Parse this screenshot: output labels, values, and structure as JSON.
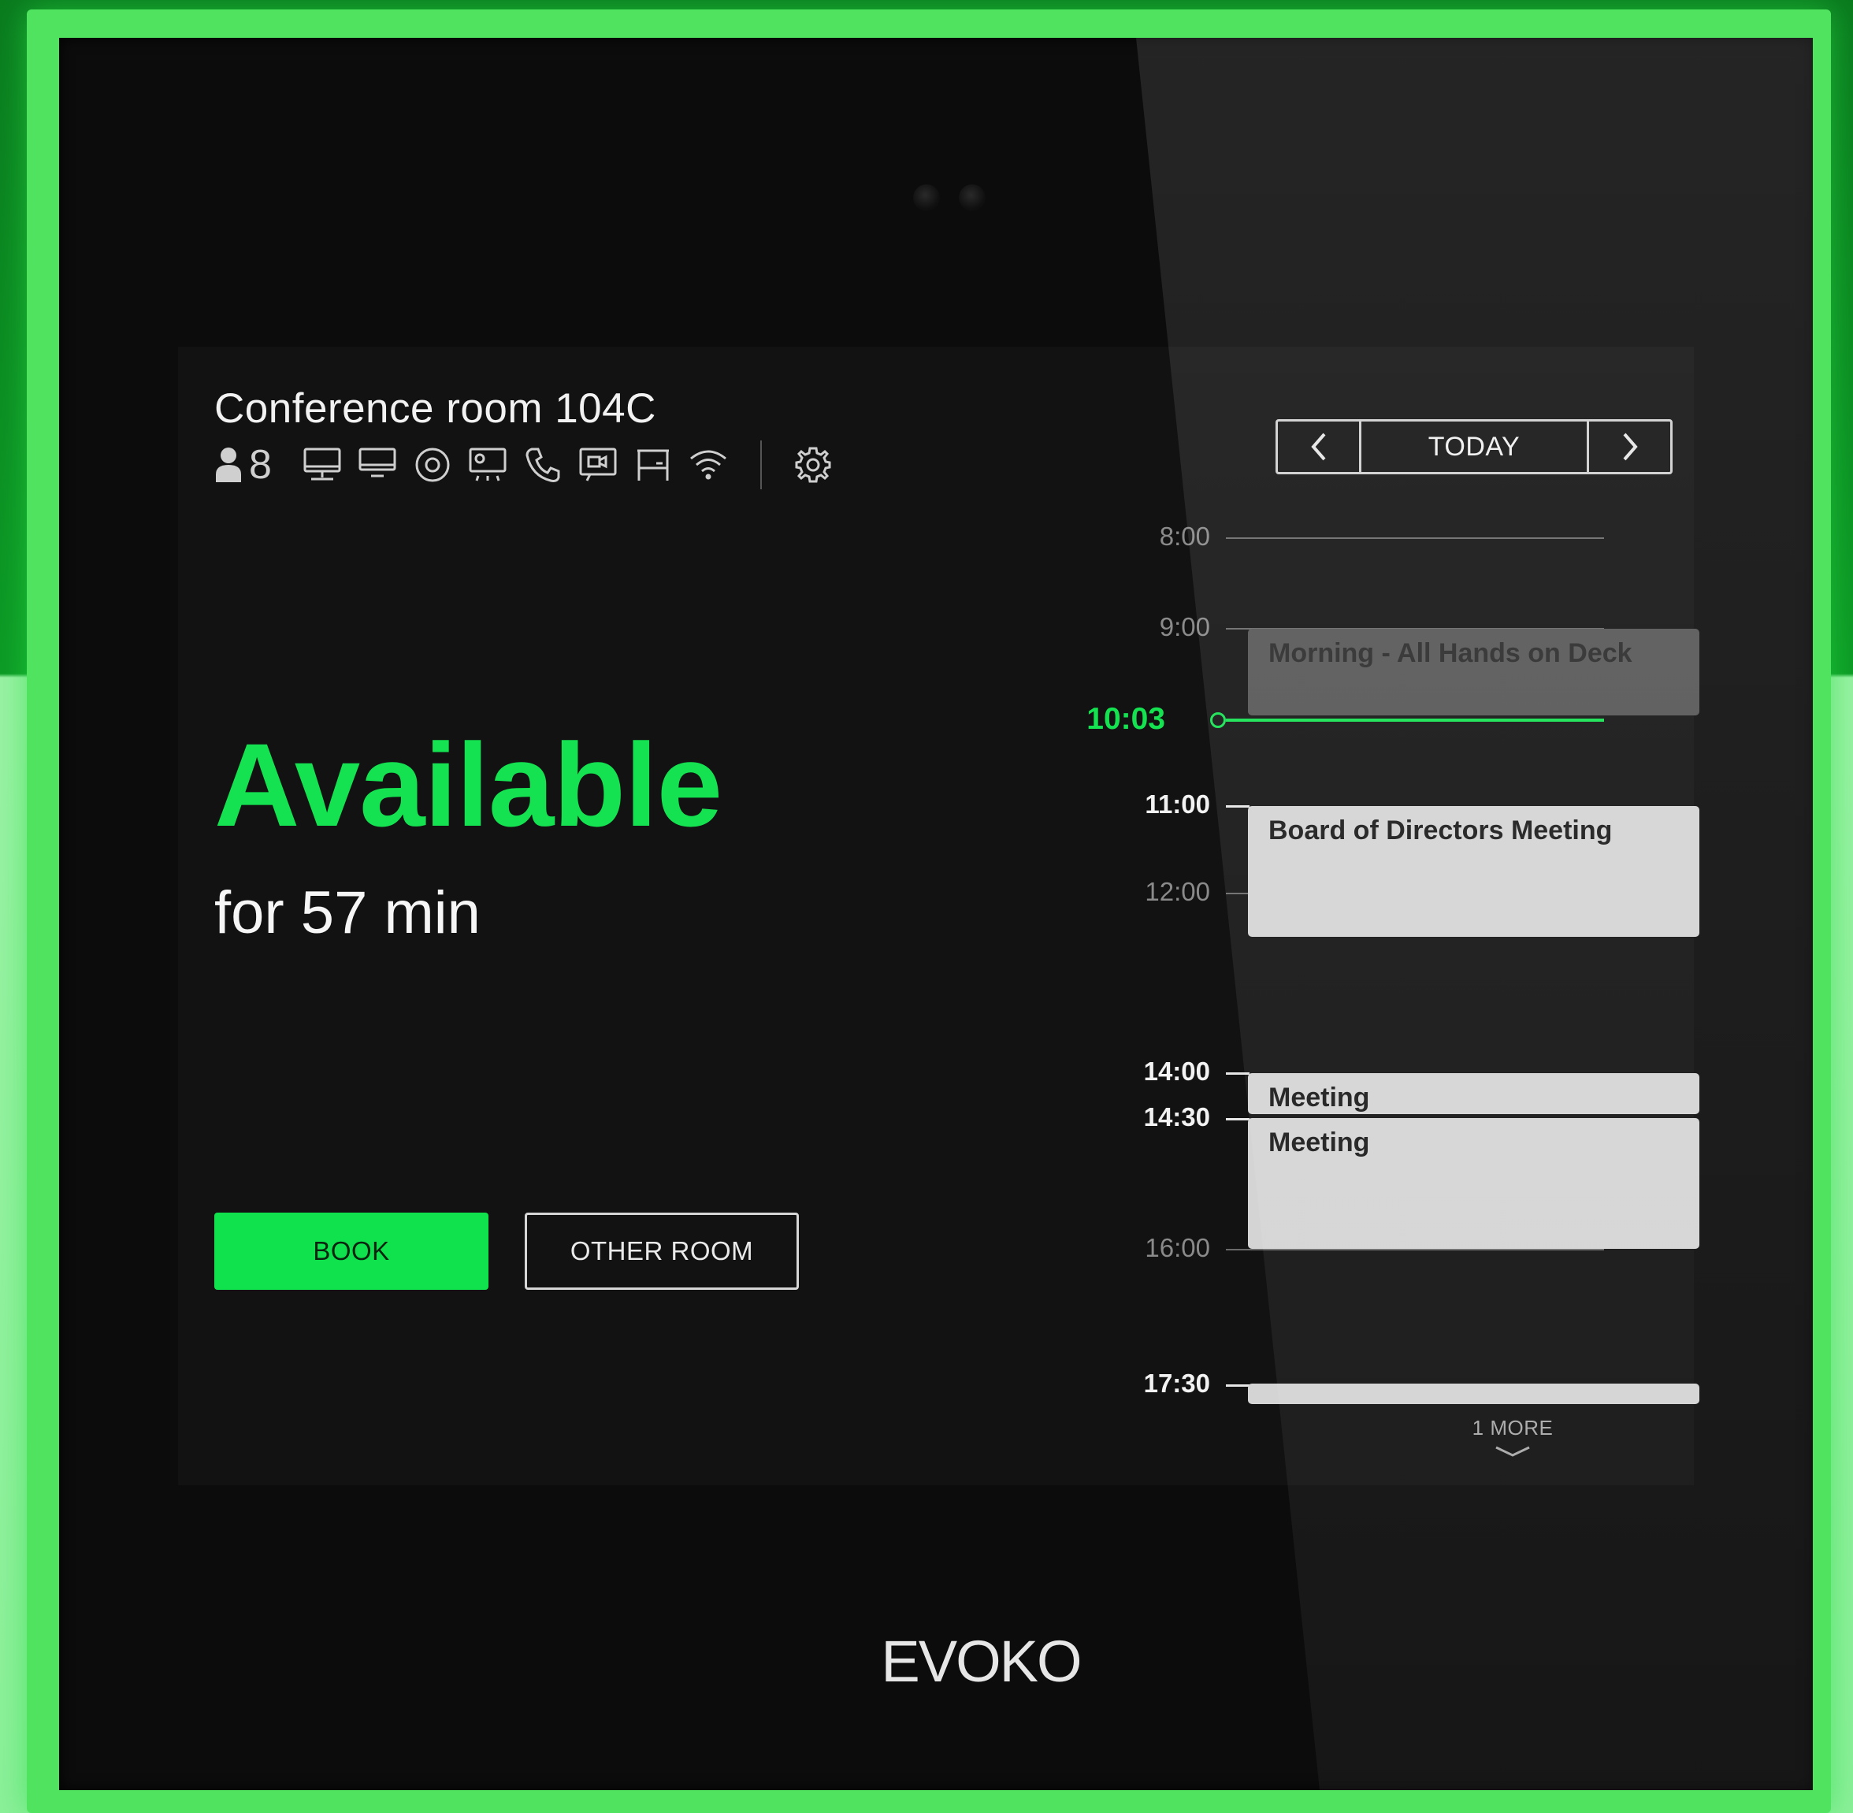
{
  "room": {
    "name": "Conference room 104C",
    "capacity": "8",
    "amenity_icons": [
      "monitor-icon",
      "display-icon",
      "webcam-icon",
      "projector-icon",
      "phone-icon",
      "video-conference-icon",
      "whiteboard-icon",
      "wifi-icon"
    ],
    "settings_icon": "gear-icon"
  },
  "status": {
    "label": "Available",
    "duration": "for 57 min",
    "color": "#14e250"
  },
  "actions": {
    "book_label": "BOOK",
    "other_room_label": "OTHER ROOM"
  },
  "date_nav": {
    "prev_icon": "chevron-left-icon",
    "today_label": "TODAY",
    "next_icon": "chevron-right-icon"
  },
  "timeline": {
    "current_time": "10:03",
    "times": [
      "8:00",
      "9:00",
      "11:00",
      "12:00",
      "14:00",
      "14:30",
      "16:00",
      "17:30"
    ],
    "events": [
      {
        "title": "Morning - All Hands on Deck",
        "state": "past"
      },
      {
        "title": "Board of Directors Meeting",
        "state": "upcoming"
      },
      {
        "title": "Meeting",
        "state": "upcoming"
      },
      {
        "title": "Meeting",
        "state": "upcoming"
      },
      {
        "title": "",
        "state": "upcoming"
      }
    ],
    "more_label": "1 MORE"
  },
  "brand": "EVOKO"
}
